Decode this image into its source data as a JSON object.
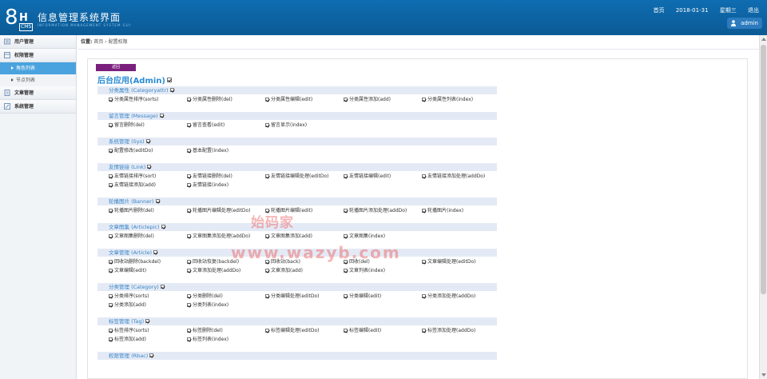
{
  "header": {
    "logo_big": "8",
    "logo_h": "H",
    "logo_cms": "CMS",
    "title": "信息管理系统界面",
    "subtitle": "INFORMATION MANAGEMENT SYSTEM GUI",
    "links": [
      "首页",
      "2018-01-31",
      "星期三",
      "退出"
    ],
    "user": "admin",
    "user_icon": "user-icon"
  },
  "sidebar": {
    "items": [
      {
        "label": "用户管理",
        "icon": "user-group-icon",
        "type": "head"
      },
      {
        "label": "权限管理",
        "icon": "permission-icon",
        "type": "head"
      },
      {
        "label": "角色列表",
        "type": "sub",
        "active": true
      },
      {
        "label": "节点列表",
        "type": "sub",
        "active": false
      },
      {
        "label": "文章管理",
        "icon": "article-icon",
        "type": "head"
      },
      {
        "label": "系统管理",
        "icon": "system-icon",
        "type": "head"
      }
    ]
  },
  "breadcrumb": {
    "label": "位置:",
    "items": [
      "首页",
      "配置权限"
    ],
    "sep": "›"
  },
  "main": {
    "back_label": "返回",
    "app_title": "后台应用(Admin)",
    "groups": [
      {
        "title": "分类属性 (Categoryattr)",
        "items": [
          "分类属性排序(sorts)",
          "分类属性删除(del)",
          "分类属性编辑(edit)",
          "分类属性添加(add)",
          "分类属性列表(index)"
        ]
      },
      {
        "title": "留言管理 (Message)",
        "items": [
          "留言删除(del)",
          "留言查看(edit)",
          "留言显示(index)"
        ]
      },
      {
        "title": "系统管理 (Sys)",
        "items": [
          "配置修改(editDo)",
          "基本配置(index)"
        ]
      },
      {
        "title": "友情链接 (Link)",
        "items": [
          "友情链接排序(sort)",
          "友情链接删除(del)",
          "友情链接编辑处理(editDo)",
          "友情链接编辑(edit)",
          "友情链接添加处理(addDo)",
          "友情链接添加(add)",
          "友情链接(index)"
        ]
      },
      {
        "title": "轮播图片 (Banner)",
        "items": [
          "轮播图片删除(del)",
          "轮播图片编辑处理(editDo)",
          "轮播图片编辑(edit)",
          "轮播图片添加处理(addDo)",
          "轮播图片(index)"
        ]
      },
      {
        "title": "文章图集 (Articlepic)",
        "items": [
          "文章图集删除(del)",
          "文章图集添加处理(addDo)",
          "文章图集添加(add)",
          "文章图集(index)"
        ]
      },
      {
        "title": "文章管理 (Article)",
        "items": [
          "回收站删除(backdel)",
          "回收站恢复(backdel)",
          "回收站(back)",
          "回收(del)",
          "文章编辑处理(editDo)",
          "文章编辑(edit)",
          "文章添加处理(addDo)",
          "文章添加(add)",
          "文章列表(index)"
        ]
      },
      {
        "title": "分类管理 (Category)",
        "items": [
          "分类排序(sorts)",
          "分类删除(del)",
          "分类编辑处理(editDo)",
          "分类编辑(edit)",
          "分类添加处理(addDo)",
          "分类添加(add)",
          "分类列表(index)"
        ]
      },
      {
        "title": "标签管理 (Tag)",
        "items": [
          "标签排序(sorts)",
          "标签删除(del)",
          "标签编辑处理(editDo)",
          "标签编辑(edit)",
          "标签添加处理(addDo)",
          "标签添加(add)",
          "标签列表(index)"
        ]
      },
      {
        "title": "权限管理 (Rbac)",
        "items": []
      }
    ]
  },
  "watermark": {
    "line1": "始码家",
    "line2": "www.wazyb.com"
  },
  "colors": {
    "header": "#0f6db1",
    "accent": "#4aa3df",
    "back_button": "#7b1f7d",
    "group_bg": "#e4eaf5",
    "link_text": "#3a86c8"
  }
}
